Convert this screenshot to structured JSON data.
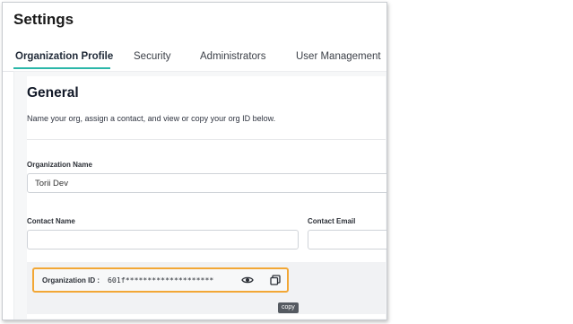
{
  "header": {
    "title": "Settings"
  },
  "tabs": [
    {
      "label": "Organization Profile",
      "active": true
    },
    {
      "label": "Security"
    },
    {
      "label": "Administrators"
    },
    {
      "label": "User Management"
    }
  ],
  "general": {
    "heading": "General",
    "description": "Name your org, assign a contact, and view or copy your org ID below."
  },
  "org_name": {
    "label": "Organization Name",
    "value": "Torii Dev"
  },
  "contact_name": {
    "label": "Contact Name",
    "value": ""
  },
  "contact_email": {
    "label": "Contact Email",
    "value": ""
  },
  "org_id": {
    "label": "Organization ID :",
    "masked_value": "601f********************",
    "reveal_icon": "eye-icon",
    "copy_icon": "copy-icon",
    "copy_tooltip": "copy"
  },
  "colors": {
    "accent": "#2bb7a9",
    "highlight": "#f2a735"
  }
}
